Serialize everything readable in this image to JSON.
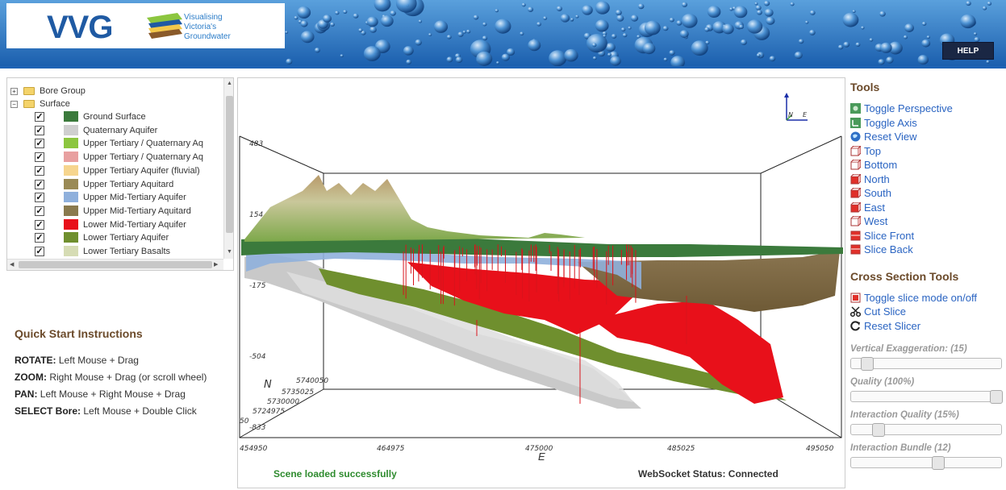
{
  "header": {
    "logo_text": "VVG",
    "tagline": [
      "Visualising",
      "Victoria's",
      "Groundwater"
    ],
    "help_label": "HELP"
  },
  "tree": {
    "groups": [
      {
        "label": "Bore Group",
        "expander": "+"
      },
      {
        "label": "Surface",
        "expander": "−"
      }
    ],
    "layers": [
      {
        "label": "Ground Surface",
        "color": "#3b7a3c",
        "checked": true
      },
      {
        "label": "Quaternary Aquifer",
        "color": "#cfcfcf",
        "checked": true
      },
      {
        "label": "Upper Tertiary / Quaternary Aq",
        "color": "#8cc63f",
        "checked": true
      },
      {
        "label": "Upper Tertiary / Quaternary Aq",
        "color": "#e8a0a0",
        "checked": true
      },
      {
        "label": "Upper Tertiary Aquifer (fluvial)",
        "color": "#f6d58e",
        "checked": true
      },
      {
        "label": "Upper Tertiary Aquitard",
        "color": "#9a8a55",
        "checked": true
      },
      {
        "label": "Upper Mid-Tertiary Aquifer",
        "color": "#8fb0dc",
        "checked": true
      },
      {
        "label": "Upper Mid-Tertiary Aquitard",
        "color": "#8a7a4e",
        "checked": true
      },
      {
        "label": "Lower Mid-Tertiary Aquifer",
        "color": "#e8101a",
        "checked": true
      },
      {
        "label": "Lower Tertiary Aquifer",
        "color": "#6f8f2e",
        "checked": true
      },
      {
        "label": "Lower Tertiary Basalts",
        "color": "#d6dcb4",
        "checked": true
      }
    ]
  },
  "quick_start": {
    "title": "Quick Start Instructions",
    "rows": [
      {
        "key": "ROTATE:",
        "value": " Left Mouse + Drag"
      },
      {
        "key": "ZOOM:",
        "value": " Right Mouse + Drag (or scroll wheel)"
      },
      {
        "key": "PAN:",
        "value": " Left Mouse + Right Mouse + Drag"
      },
      {
        "key": "SELECT Bore:",
        "value": " Left Mouse + Double Click"
      }
    ]
  },
  "viewer": {
    "z_ticks": [
      "483",
      "154",
      "-175",
      "-504",
      "-833"
    ],
    "x_ticks": [
      "454950",
      "464975",
      "475000",
      "485025",
      "495050"
    ],
    "y_ticks": [
      "5740050",
      "5735025",
      "5730000",
      "5724975",
      "50"
    ],
    "x_axis_label": "E",
    "y_axis_label": "N",
    "compass_n": "N",
    "compass_e": "E",
    "status": "Scene loaded successfully",
    "ws_status": "WebSocket Status: Connected"
  },
  "tools": {
    "title": "Tools",
    "items": [
      {
        "label": "Toggle Perspective",
        "icon": "perspective-icon"
      },
      {
        "label": "Toggle Axis",
        "icon": "axis-icon"
      },
      {
        "label": "Reset View",
        "icon": "globe-icon"
      },
      {
        "label": "Top",
        "icon": "cube-top-icon"
      },
      {
        "label": "Bottom",
        "icon": "cube-bottom-icon"
      },
      {
        "label": "North",
        "icon": "cube-north-icon"
      },
      {
        "label": "South",
        "icon": "cube-south-icon"
      },
      {
        "label": "East",
        "icon": "cube-east-icon"
      },
      {
        "label": "West",
        "icon": "cube-west-icon"
      },
      {
        "label": "Slice Front",
        "icon": "slice-front-icon"
      },
      {
        "label": "Slice Back",
        "icon": "slice-back-icon"
      }
    ],
    "cross_title": "Cross Section Tools",
    "cross_items": [
      {
        "label": "Toggle slice mode on/off",
        "icon": "slice-mode-icon"
      },
      {
        "label": "Cut Slice",
        "icon": "scissors-icon"
      },
      {
        "label": "Reset Slicer",
        "icon": "reset-icon"
      }
    ],
    "sliders": [
      {
        "label": "Vertical Exaggeration: (15)",
        "fraction": 0.07
      },
      {
        "label": "Quality (100%)",
        "fraction": 1.0
      },
      {
        "label": "Interaction Quality (15%)",
        "fraction": 0.15
      },
      {
        "label": "Interaction Bundle (12)",
        "fraction": 0.58
      }
    ]
  }
}
